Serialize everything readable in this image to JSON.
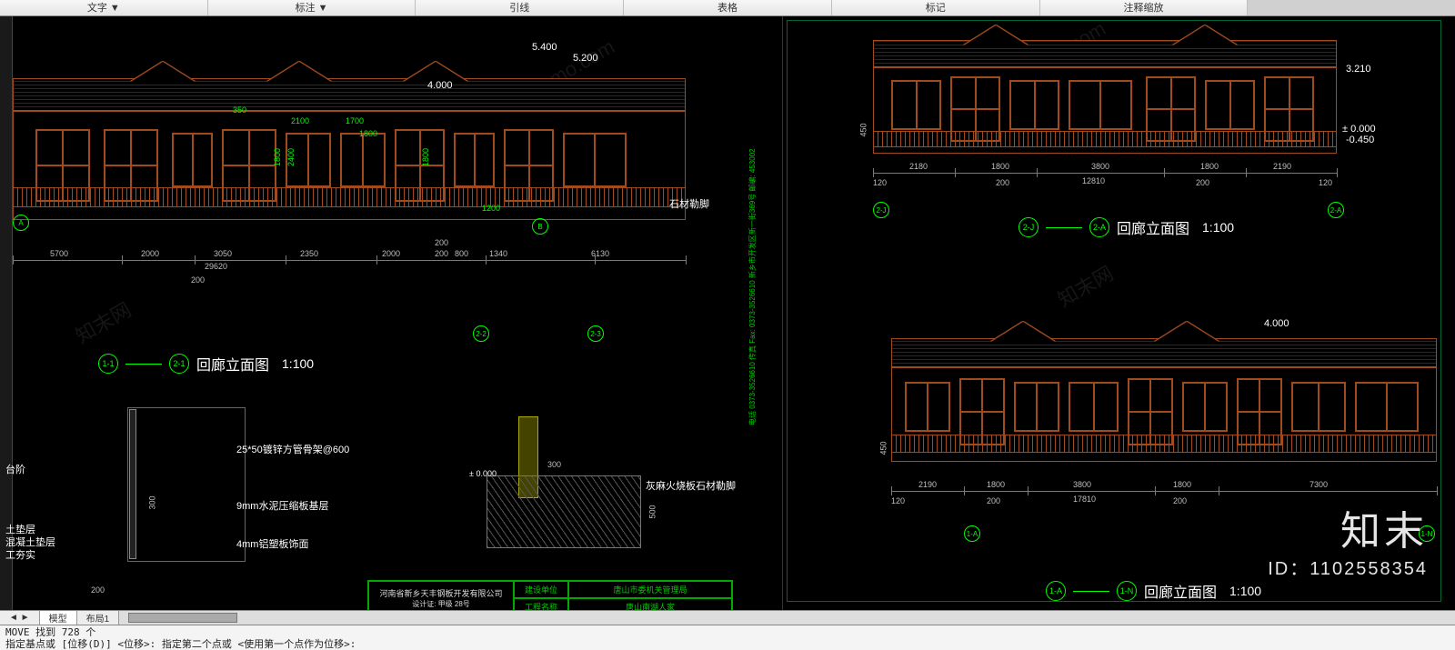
{
  "menubar": {
    "items": [
      "文字 ▼",
      "标注 ▼",
      "引线",
      "表格",
      "标记",
      "注释缩放",
      ""
    ]
  },
  "drawing": {
    "elev_title": "回廊立面图",
    "scale": "1:100",
    "grid_labels": {
      "g1": "1-1",
      "g24": "2-1",
      "g2j": "2-J",
      "g22": "2-2",
      "g23": "2-3",
      "g2a": "2-A",
      "g1a": "1-A",
      "g1n": "1-N"
    },
    "levels": {
      "l54": "5.400",
      "l52": "5.200",
      "l40": "4.000",
      "l0": "± 0.000",
      "ln045": "-0.450",
      "l321": "3.210"
    },
    "dims": {
      "d5700": "5700",
      "d2000": "2000",
      "d3050": "3050",
      "d29620": "29620",
      "d2350": "2350",
      "d200": "200",
      "d800": "800",
      "d1340": "1340",
      "d6130": "6130",
      "d2100": "2100",
      "d1700": "1700",
      "d1800": "1800",
      "d350": "350",
      "d2400": "2400",
      "d1200": "1200",
      "d450": "450",
      "d2180": "2180",
      "d3800": "3800",
      "d2190": "2190",
      "d12810": "12810",
      "d120": "120",
      "d17810": "17810",
      "d7300": "7300",
      "d300": "300",
      "d500": "500"
    },
    "annotations": {
      "stone_plinth": "石材勒脚",
      "granite_plinth": "灰麻火烧板石材勒脚",
      "galv_tube": "25*50镀锌方管骨架@600",
      "cement_board": "9mm水泥压缩板基层",
      "alu_panel": "4mm铝塑板饰面",
      "step": "台阶",
      "soil_cushion": "土垫层",
      "concrete_cushion": "混凝土垫层",
      "compact": "工夯实"
    },
    "titleblock": {
      "company": "河南省新乡天丰钢板开发有限公司",
      "design_label": "设计证: 甲级  28号",
      "owner_label": "建设单位",
      "owner": "唐山市委机关管理局",
      "proj_label": "工程名称",
      "proj": "唐山南湖人家",
      "contact": "电话 0373-3526610\n传真 Fax: 0373-3526610\n新乡市开发区新一街369号\n邮编: 453002"
    },
    "section_marks": {
      "a": "A",
      "b": "B"
    }
  },
  "overlay": {
    "watermark": "知末",
    "id_label": "ID：1102558354",
    "diag": "www.znzmo.com",
    "diag2": "知末网"
  },
  "tabs": {
    "nav": "◄ ►",
    "model": "模型",
    "layout1": "布局1"
  },
  "command": {
    "line1": "MOVE 找到 728 个",
    "line2": "指定基点或 [位移(D)] <位移>:  指定第二个点或 <使用第一个点作为位移>:"
  }
}
